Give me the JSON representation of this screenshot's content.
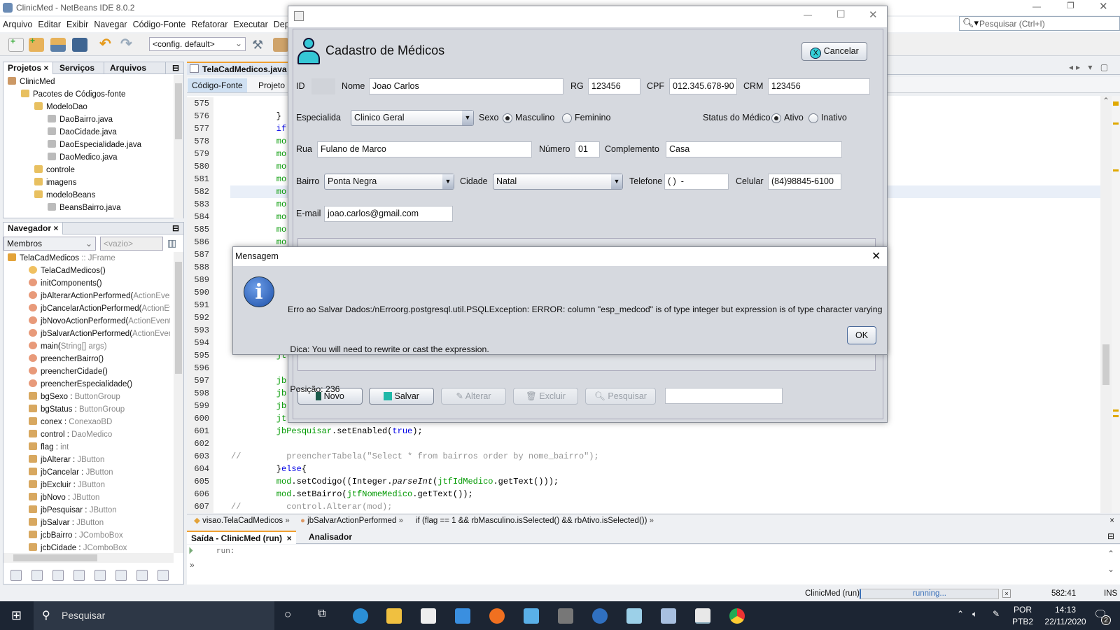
{
  "ide": {
    "title": "ClinicMed - NetBeans IDE 8.0.2",
    "menu": [
      "Arquivo",
      "Editar",
      "Exibir",
      "Navegar",
      "Código-Fonte",
      "Refatorar",
      "Executar",
      "Depur"
    ],
    "config": "<config. default>",
    "search_placeholder": "Pesquisar (Ctrl+I)"
  },
  "projects": {
    "tabs": [
      "Projetos",
      "Serviços",
      "Arquivos"
    ],
    "tree": [
      {
        "t": "ClinicMed",
        "l": 0,
        "c": "#c96"
      },
      {
        "t": "Pacotes de Códigos-fonte",
        "l": 1,
        "c": "#e8c060"
      },
      {
        "t": "ModeloDao",
        "l": 2,
        "c": "#e8c060"
      },
      {
        "t": "DaoBairro.java",
        "l": 3,
        "c": "#bbb"
      },
      {
        "t": "DaoCidade.java",
        "l": 3,
        "c": "#bbb"
      },
      {
        "t": "DaoEspecialidade.java",
        "l": 3,
        "c": "#bbb"
      },
      {
        "t": "DaoMedico.java",
        "l": 3,
        "c": "#bbb"
      },
      {
        "t": "controle",
        "l": 2,
        "c": "#e8c060"
      },
      {
        "t": "imagens",
        "l": 2,
        "c": "#e8c060"
      },
      {
        "t": "modeloBeans",
        "l": 2,
        "c": "#e8c060"
      },
      {
        "t": "BeansBairro.java",
        "l": 3,
        "c": "#bbb"
      }
    ]
  },
  "navigator": {
    "title": "Navegador",
    "filter": "Membros",
    "filter2": "<vazio>",
    "root": {
      "name": "TelaCadMedicos",
      "type": " :: JFrame"
    },
    "items": [
      {
        "n": "TelaCadMedicos()",
        "t": ""
      },
      {
        "n": "initComponents()",
        "t": ""
      },
      {
        "n": "jbAlterarActionPerformed(",
        "t": "ActionEver"
      },
      {
        "n": "jbCancelarActionPerformed(",
        "t": "ActionEv"
      },
      {
        "n": "jbNovoActionPerformed(",
        "t": "ActionEvent"
      },
      {
        "n": "jbSalvarActionPerformed(",
        "t": "ActionEven"
      },
      {
        "n": "main(",
        "t": "String[] args)"
      },
      {
        "n": "preencherBairro()",
        "t": ""
      },
      {
        "n": "preencherCidade()",
        "t": ""
      },
      {
        "n": "preencherEspecialidade()",
        "t": ""
      },
      {
        "n": "bgSexo : ",
        "t": "ButtonGroup"
      },
      {
        "n": "bgStatus : ",
        "t": "ButtonGroup"
      },
      {
        "n": "conex : ",
        "t": "ConexaoBD"
      },
      {
        "n": "control : ",
        "t": "DaoMedico"
      },
      {
        "n": "flag : ",
        "t": "int"
      },
      {
        "n": "jbAlterar : ",
        "t": "JButton"
      },
      {
        "n": "jbCancelar : ",
        "t": "JButton"
      },
      {
        "n": "jbExcluir : ",
        "t": "JButton"
      },
      {
        "n": "jbNovo : ",
        "t": "JButton"
      },
      {
        "n": "jbPesquisar : ",
        "t": "JButton"
      },
      {
        "n": "jbSalvar : ",
        "t": "JButton"
      },
      {
        "n": "jcbBairro : ",
        "t": "JComboBox"
      },
      {
        "n": "jcbCidade : ",
        "t": "JComboBox"
      }
    ]
  },
  "editor": {
    "file_tab": "TelaCadMedicos.java",
    "subtabs": [
      "Código-Fonte",
      "Projeto"
    ],
    "lines": [
      {
        "n": "575",
        "s": []
      },
      {
        "n": "576",
        "s": [
          [
            "         }",
            "pl"
          ]
        ]
      },
      {
        "n": "577",
        "s": [
          [
            "         if",
            "kw"
          ]
        ]
      },
      {
        "n": "578",
        "s": [
          [
            "         mo",
            "id"
          ]
        ]
      },
      {
        "n": "579",
        "s": [
          [
            "         mo",
            "id"
          ]
        ]
      },
      {
        "n": "580",
        "s": [
          [
            "         mo",
            "id"
          ]
        ]
      },
      {
        "n": "581",
        "s": [
          [
            "         mo",
            "id"
          ]
        ]
      },
      {
        "n": "582",
        "s": [
          [
            "         mo",
            "id"
          ]
        ]
      },
      {
        "n": "583",
        "s": [
          [
            "         mo",
            "id"
          ]
        ]
      },
      {
        "n": "584",
        "s": [
          [
            "         mo",
            "id"
          ]
        ]
      },
      {
        "n": "585",
        "s": [
          [
            "         mo",
            "id"
          ]
        ]
      },
      {
        "n": "586",
        "s": [
          [
            "         mo",
            "id"
          ]
        ]
      },
      {
        "n": "587",
        "s": []
      },
      {
        "n": "588",
        "s": []
      },
      {
        "n": "589",
        "s": []
      },
      {
        "n": "590",
        "s": []
      },
      {
        "n": "591",
        "s": []
      },
      {
        "n": "592",
        "s": []
      },
      {
        "n": "593",
        "s": []
      },
      {
        "n": "594",
        "s": []
      },
      {
        "n": "595",
        "s": [
          [
            "         jt",
            "id"
          ]
        ]
      },
      {
        "n": "596",
        "s": []
      },
      {
        "n": "597",
        "s": [
          [
            "         jb",
            "id"
          ]
        ]
      },
      {
        "n": "598",
        "s": [
          [
            "         jb",
            "id"
          ]
        ]
      },
      {
        "n": "599",
        "s": [
          [
            "         jb",
            "id"
          ]
        ]
      },
      {
        "n": "600",
        "s": [
          [
            "         jt",
            "id"
          ]
        ]
      },
      {
        "n": "601",
        "s": [
          [
            "         jbPesquisar",
            "id"
          ],
          [
            ".setEnabled(",
            "pl"
          ],
          [
            "true",
            "kw"
          ],
          [
            ");",
            "pl"
          ]
        ]
      },
      {
        "n": "602",
        "s": []
      },
      {
        "n": "603",
        "s": [
          [
            "//         preencherTabela(\"Select * from bairros order by nome_bairro\");",
            "cm"
          ]
        ]
      },
      {
        "n": "604",
        "s": [
          [
            "         }",
            "pl"
          ],
          [
            "else",
            "kw"
          ],
          [
            "{",
            "pl"
          ]
        ]
      },
      {
        "n": "605",
        "s": [
          [
            "         mod",
            "id"
          ],
          [
            ".setCodigo((Integer.",
            "pl"
          ],
          [
            "parseInt",
            "it"
          ],
          [
            "(",
            "pl"
          ],
          [
            "jtfIdMedico",
            "id"
          ],
          [
            ".getText()));",
            "pl"
          ]
        ]
      },
      {
        "n": "606",
        "s": [
          [
            "         mod",
            "id"
          ],
          [
            ".setBairro(",
            "pl"
          ],
          [
            "jtfNomeMedico",
            "id"
          ],
          [
            ".getText());",
            "pl"
          ]
        ]
      },
      {
        "n": "607",
        "s": [
          [
            "//         control.Alterar(mod);",
            "cm"
          ]
        ]
      }
    ],
    "breadcrumb": [
      "visao.TelaCadMedicos",
      "jbSalvarActionPerformed",
      "if (flag == 1 && rbMasculino.isSelected() && rbAtivo.isSelected())"
    ]
  },
  "output": {
    "tabs": [
      "Saída - ClinicMed (run)",
      "Analisador"
    ],
    "text": "run:"
  },
  "status": {
    "project": "ClinicMed (run)",
    "progress": "running...",
    "position": "582:41",
    "mode": "INS"
  },
  "form": {
    "title": "Cadastro de Médicos",
    "cancel": "Cancelar",
    "labels": {
      "id": "ID",
      "nome": "Nome",
      "rg": "RG",
      "cpf": "CPF",
      "crm": "CRM",
      "esp": "Especialida",
      "sexo": "Sexo",
      "masc": "Masculino",
      "fem": "Feminino",
      "status": "Status do Médico",
      "ativo": "Ativo",
      "inativo": "Inativo",
      "rua": "Rua",
      "numero": "Número",
      "compl": "Complemento",
      "bairro": "Bairro",
      "cidade": "Cidade",
      "tel": "Telefone",
      "cel": "Celular",
      "email": "E-mail"
    },
    "values": {
      "id": "",
      "nome": "Joao Carlos",
      "rg": "123456",
      "cpf": "012.345.678-90",
      "crm": "123456",
      "esp": "Clinico Geral",
      "rua": "Fulano de Marco",
      "numero": "01",
      "compl": "Casa",
      "bairro": "Ponta Negra",
      "cidade": "Natal",
      "tel": "( )  -",
      "cel": "(84)98845-6100",
      "email": "joao.carlos@gmail.com",
      "search": ""
    },
    "sexo": "Masculino",
    "status_medico": "Ativo",
    "buttons": {
      "novo": "Novo",
      "salvar": "Salvar",
      "alterar": "Alterar",
      "excluir": "Excluir",
      "pesquisar": "Pesquisar"
    }
  },
  "dialog": {
    "title": "Mensagem",
    "line1": "Erro ao Salvar Dados:/nErroorg.postgresql.util.PSQLException: ERROR: column \"esp_medcod\" is of type integer but expression is of type character varying",
    "line2": " Dica: You will need to rewrite or cast the expression.",
    "line3": " Posição: 236",
    "ok": "OK"
  },
  "taskbar": {
    "search": "Pesquisar",
    "lang1": "POR",
    "lang2": "PTB2",
    "time": "14:13",
    "date": "22/11/2020",
    "notifications": "2"
  }
}
